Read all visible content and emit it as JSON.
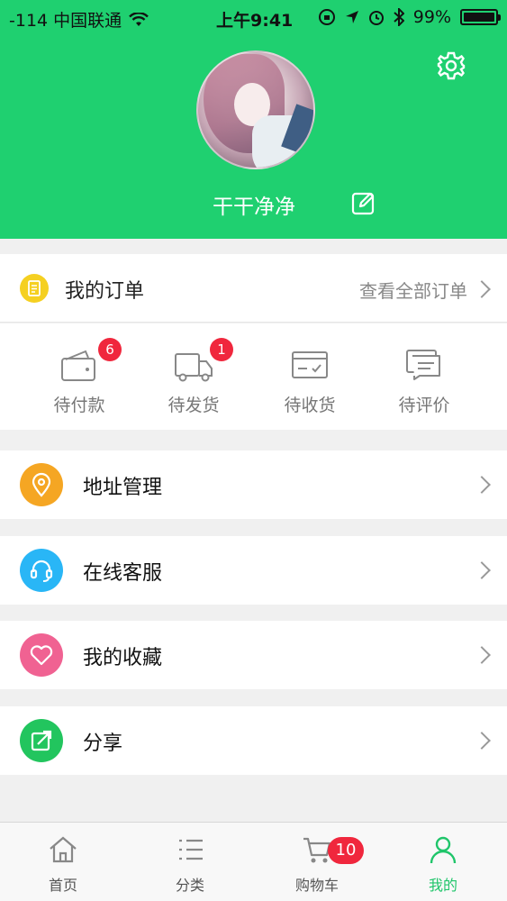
{
  "status_bar": {
    "carrier": "-114 中国联通",
    "time": "上午9:41",
    "battery": "99%",
    "battery_level": 0.99
  },
  "profile": {
    "username": "干干净净"
  },
  "orders": {
    "title": "我的订单",
    "view_all": "查看全部订单",
    "statuses": [
      {
        "label": "待付款",
        "badge": "6",
        "icon": "wallet-icon"
      },
      {
        "label": "待发货",
        "badge": "1",
        "icon": "truck-icon"
      },
      {
        "label": "待收货",
        "badge": "",
        "icon": "package-icon"
      },
      {
        "label": "待评价",
        "badge": "",
        "icon": "comment-icon"
      }
    ]
  },
  "menu": [
    {
      "label": "地址管理",
      "icon": "location-pin-icon",
      "color": "#f5a623"
    },
    {
      "label": "在线客服",
      "icon": "headset-icon",
      "color": "#29b6f6"
    },
    {
      "label": "我的收藏",
      "icon": "heart-icon",
      "color": "#f06292"
    },
    {
      "label": "分享",
      "icon": "share-icon",
      "color": "#22c55e"
    }
  ],
  "tabbar": {
    "items": [
      {
        "label": "首页",
        "icon": "home-icon"
      },
      {
        "label": "分类",
        "icon": "category-list-icon"
      },
      {
        "label": "购物车",
        "icon": "cart-icon",
        "badge": "10"
      },
      {
        "label": "我的",
        "icon": "user-icon",
        "active": true
      }
    ]
  },
  "colors": {
    "brand_green": "#1fd070",
    "badge_red": "#f0273d"
  }
}
